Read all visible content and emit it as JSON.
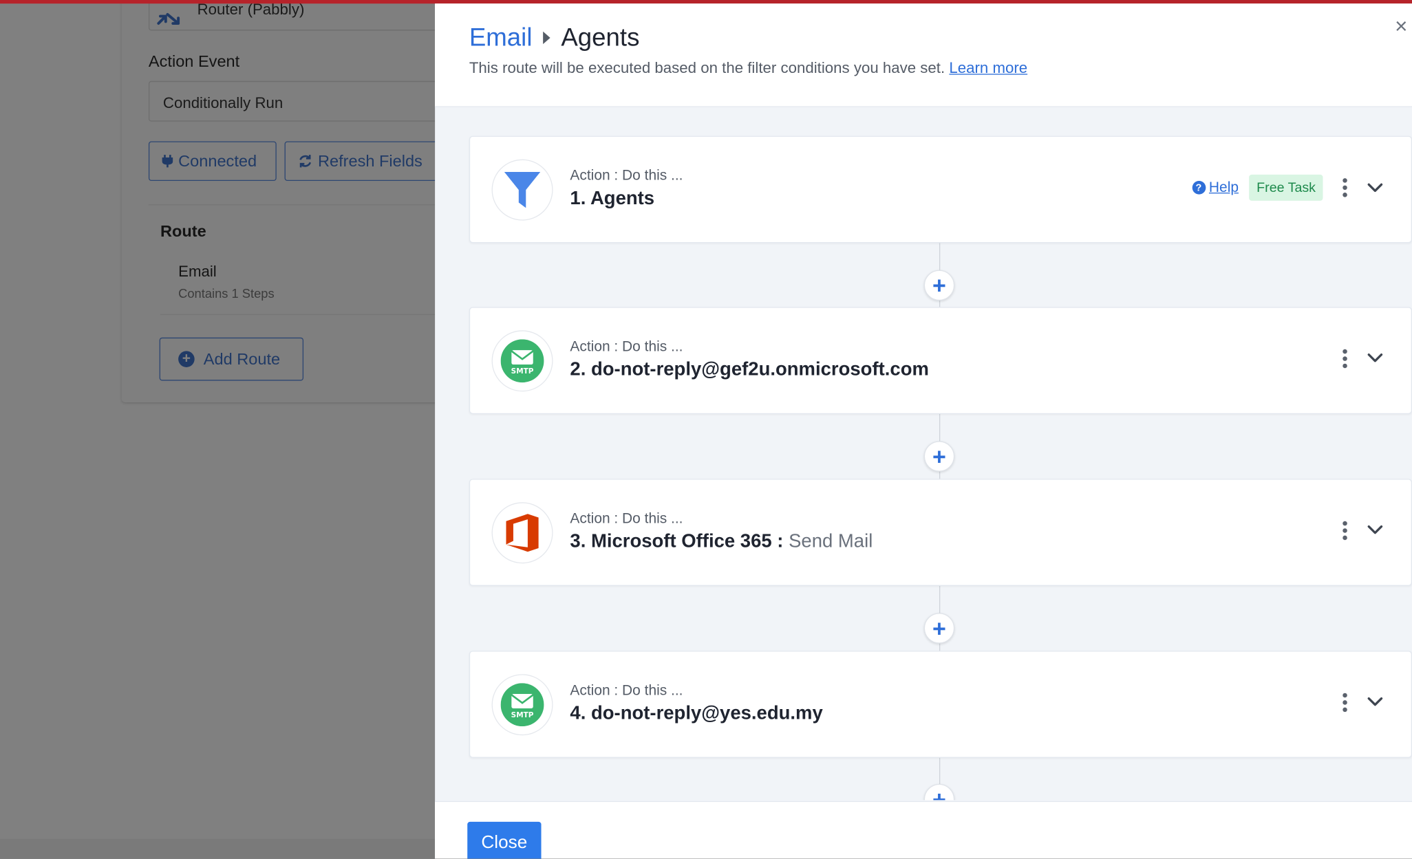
{
  "background": {
    "router_label": "Router (Pabbly)",
    "action_event_label": "Action Event",
    "action_event_value": "Conditionally Run",
    "connected_label": "Connected",
    "refresh_label": "Refresh Fields",
    "route_title": "Route",
    "route_name": "Email",
    "route_steps": "Contains 1 Steps",
    "add_route_label": "Add Route"
  },
  "drawer": {
    "breadcrumb_parent": "Email",
    "breadcrumb_current": "Agents",
    "description": "This route will be executed based on the filter conditions you have set.",
    "learn_more": "Learn more",
    "close_glyph": "×",
    "close_button": "Close",
    "add_step_glyph": "+"
  },
  "steps": [
    {
      "kicker": "Action : Do this ...",
      "title": "1. Agents",
      "icon": "filter-icon",
      "help": "Help",
      "badge": "Free Task"
    },
    {
      "kicker": "Action : Do this ...",
      "title": "2. do-not-reply@gef2u.onmicrosoft.com",
      "icon": "smtp-icon"
    },
    {
      "kicker": "Action : Do this ...",
      "title": "3. Microsoft Office 365 :",
      "subtitle": "Send Mail",
      "icon": "office365-icon"
    },
    {
      "kicker": "Action : Do this ...",
      "title": "4. do-not-reply@yes.edu.my",
      "icon": "smtp-icon"
    }
  ],
  "colors": {
    "accent": "#2e6ed8",
    "top_bar": "#b6232a",
    "smtp_green": "#3bb56e",
    "office_red": "#d83b01",
    "free_badge_bg": "#d9f5e3",
    "free_badge_text": "#1e8a4c"
  }
}
